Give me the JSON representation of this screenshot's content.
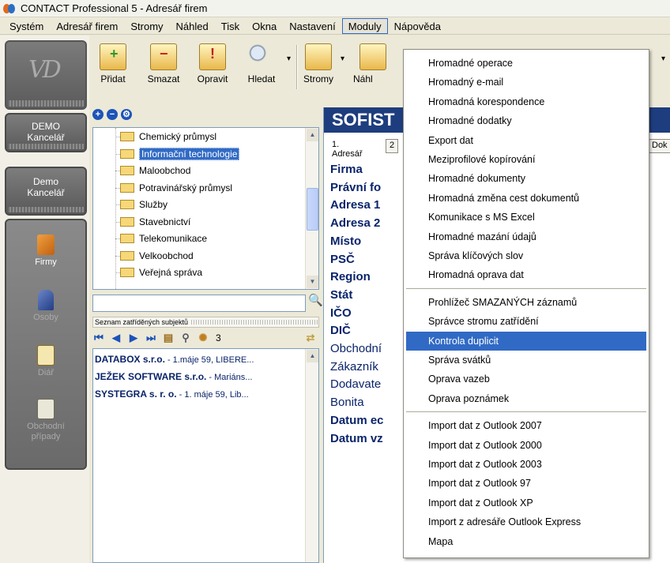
{
  "window": {
    "title": "CONTACT Professional 5 - Adresář firem"
  },
  "menubar": [
    "Systém",
    "Adresář firem",
    "Stromy",
    "Náhled",
    "Tisk",
    "Okna",
    "Nastavení",
    "Moduly",
    "Nápověda"
  ],
  "leftnav": {
    "demo_office": "DEMO\nKancelář",
    "demo_office2": "Demo\nKancelář",
    "items": [
      {
        "label": "Firmy",
        "active": true
      },
      {
        "label": "Osoby",
        "active": false
      },
      {
        "label": "Diář",
        "active": false
      },
      {
        "label": "Obchodní případy",
        "active": false
      }
    ]
  },
  "toolbar": {
    "add": "Přidat",
    "delete": "Smazat",
    "edit": "Opravit",
    "find": "Hledat",
    "trees": "Stromy",
    "preview": "Náhl"
  },
  "tree": {
    "nodes": [
      "Chemický průmysl",
      "Informační technologie",
      "Maloobchod",
      "Potravinářský průmysl",
      "Služby",
      "Stavebnictví",
      "Telekomunikace",
      "Velkoobchod",
      "Veřejná správa"
    ],
    "selected_index": 1
  },
  "list": {
    "header": "Seznam zatříděných subjektů",
    "count": "3",
    "rows": [
      {
        "name": "DATABOX s.r.o.",
        "addr": " - 1.máje 59, LIBERE..."
      },
      {
        "name": "JEŽEK SOFTWARE s.r.o.",
        "addr": " - Mariáns..."
      },
      {
        "name": "SYSTEGRA s. r. o.",
        "addr": " - 1. máje 59, Lib..."
      }
    ]
  },
  "detail": {
    "header": "SOFIST",
    "tabs": [
      "1. Adresář",
      "2",
      "Dok"
    ],
    "fields": [
      {
        "label": "Firma",
        "bold": true
      },
      {
        "label": "Právní fo",
        "bold": true
      },
      {
        "label": "Adresa 1",
        "bold": true
      },
      {
        "label": "Adresa 2",
        "bold": true
      },
      {
        "label": "Místo",
        "bold": true
      },
      {
        "label": "PSČ",
        "bold": true
      },
      {
        "label": "Region",
        "bold": true
      },
      {
        "label": "Stát",
        "bold": true
      },
      {
        "label": "IČO",
        "bold": true
      },
      {
        "label": "DIČ",
        "bold": true
      },
      {
        "label": "Obchodní",
        "bold": false
      },
      {
        "label": "Zákazník",
        "bold": false
      },
      {
        "label": "Dodavate",
        "bold": false
      },
      {
        "label": "Bonita",
        "bold": false
      },
      {
        "label": "Datum ec",
        "bold": true
      },
      {
        "label": "Datum vz",
        "bold": true
      }
    ]
  },
  "dropdown": {
    "groups": [
      [
        "Hromadné operace",
        "Hromadný e-mail",
        "Hromadná korespondence",
        "Hromadné dodatky",
        "Export dat",
        "Meziprofilové kopírování",
        "Hromadné dokumenty",
        "Hromadná změna cest dokumentů",
        "Komunikace s MS Excel",
        "Hromadné mazání údajů",
        "Správa klíčových slov",
        "Hromadná oprava dat"
      ],
      [
        "Prohlížeč SMAZANÝCH záznamů",
        "Správce stromu zatřídění",
        "Kontrola duplicit",
        "Správa svátků",
        "Oprava vazeb",
        "Oprava poznámek"
      ],
      [
        "Import dat z Outlook 2007",
        "Import dat z Outlook 2000",
        "Import dat z Outlook 2003",
        "Import dat z Outlook 97",
        "Import dat z Outlook XP",
        "Import z adresáře Outlook Express",
        "Mapa"
      ]
    ],
    "highlighted": "Kontrola duplicit"
  }
}
